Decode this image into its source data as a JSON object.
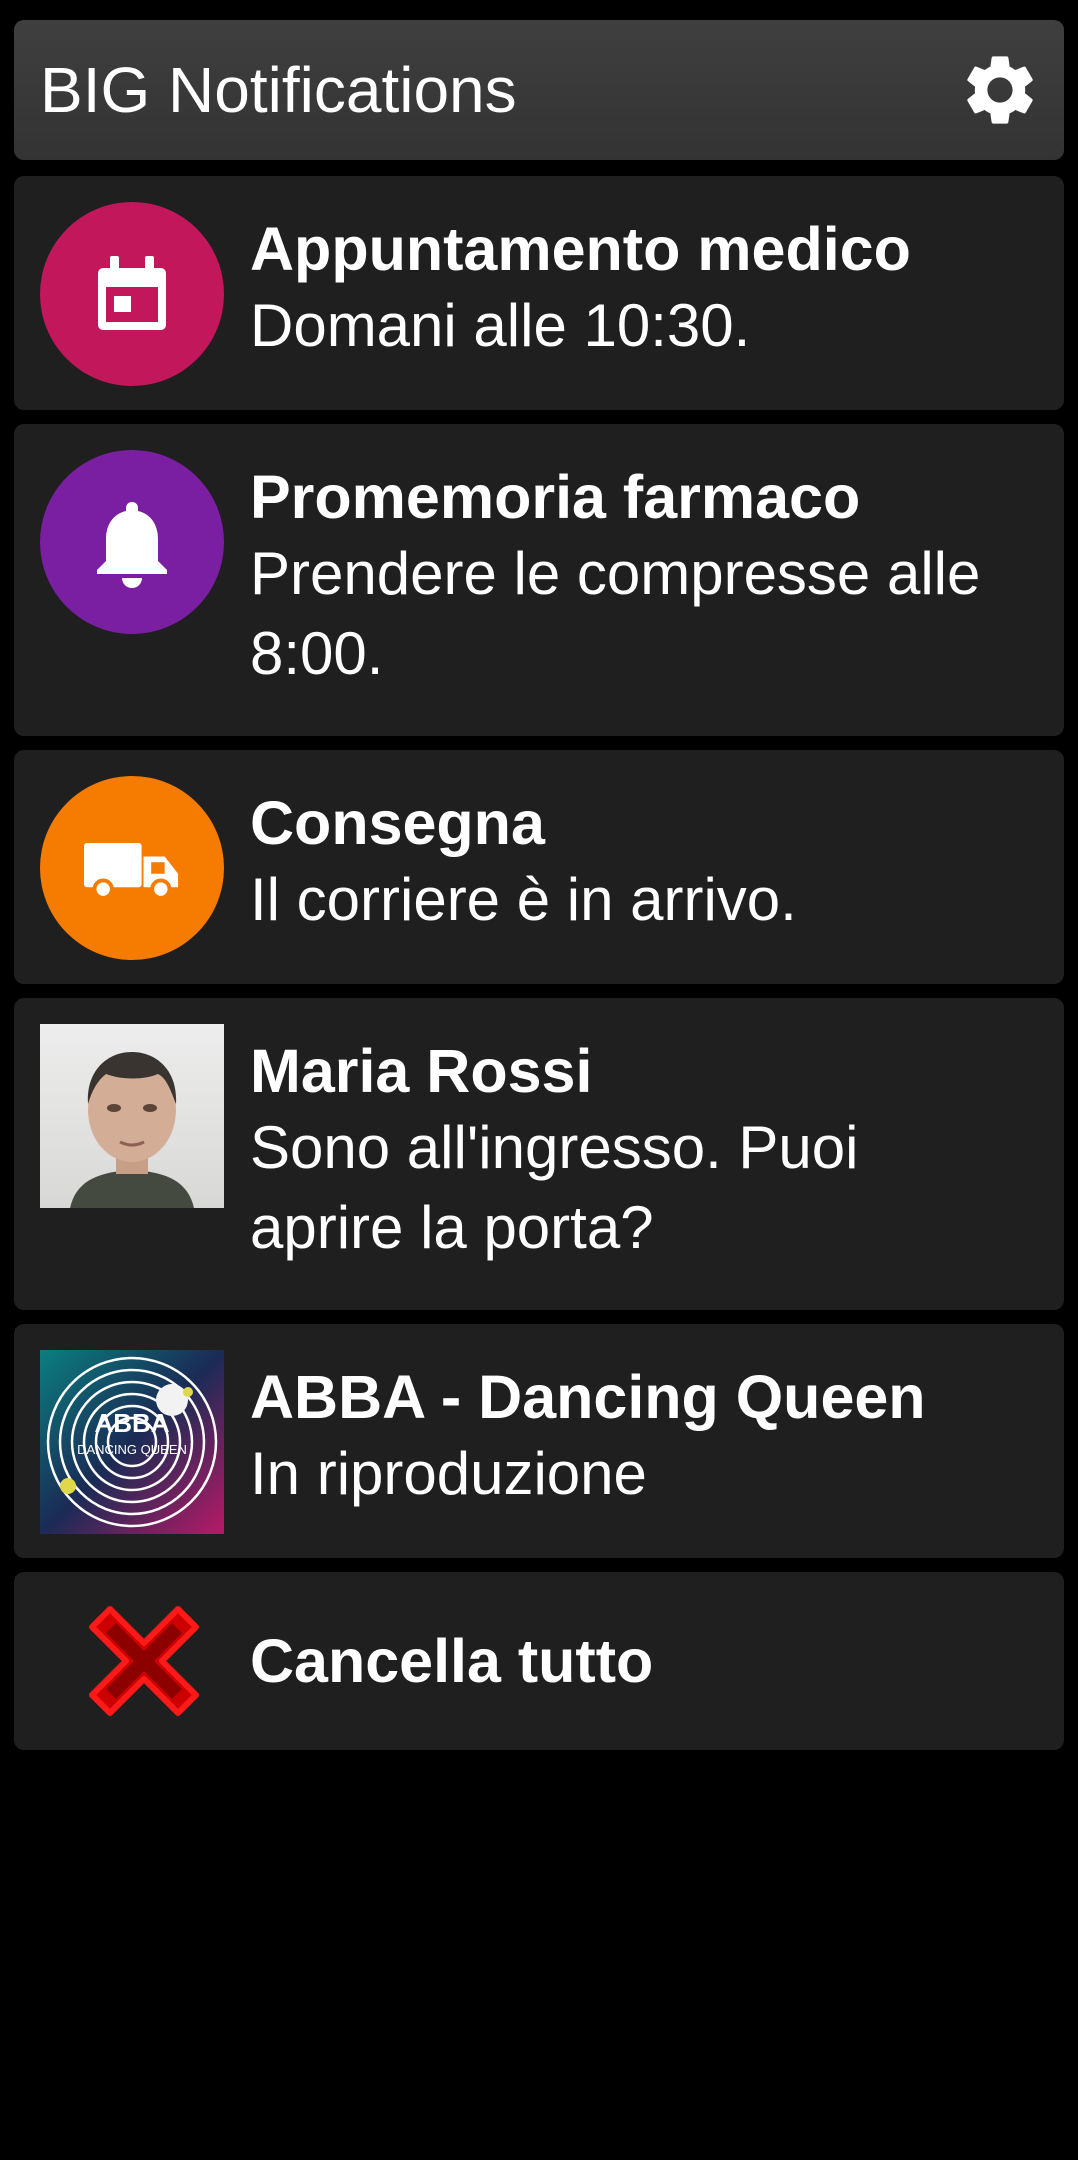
{
  "header": {
    "title": "BIG Notifications",
    "settings_icon": "gear-icon"
  },
  "notifications": [
    {
      "title": "Appuntamento medico",
      "message": "Domani alle 10:30.",
      "icon": "calendar-icon",
      "icon_color": "#c2185b"
    },
    {
      "title": "Promemoria farmaco",
      "message": "Prendere le compresse alle 8:00.",
      "icon": "bell-icon",
      "icon_color": "#7b1fa2"
    },
    {
      "title": "Consegna",
      "message": "Il corriere è in arrivo.",
      "icon": "truck-icon",
      "icon_color": "#f57c00"
    },
    {
      "title": "Maria Rossi",
      "message": "Sono all'ingresso. Puoi aprire la porta?",
      "icon": "contact-photo"
    },
    {
      "title": "ABBA - Dancing Queen",
      "message": "In riproduzione",
      "icon": "album-art",
      "album_text": "ABBA",
      "album_subtext": "DANCING QUEEN"
    }
  ],
  "clear_all": {
    "label": "Cancella tutto",
    "icon": "close-icon",
    "icon_color": "#cc0000"
  },
  "colors": {
    "background": "#000000",
    "card": "#1f1f1f",
    "header": "#3a3a3a",
    "text": "#ffffff"
  }
}
